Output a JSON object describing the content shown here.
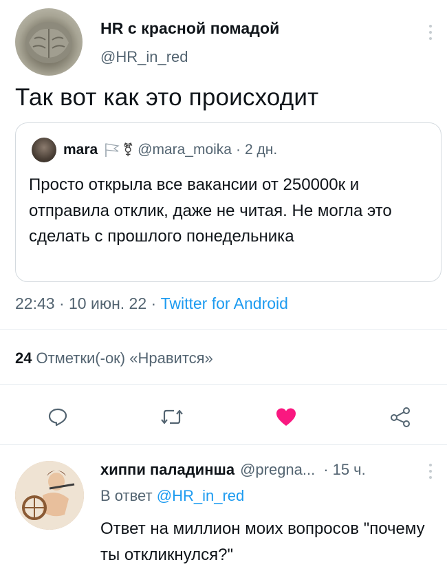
{
  "tweet": {
    "author_name": "HR с красной помадой",
    "author_handle": "@HR_in_red",
    "text": "Так вот как это происходит",
    "timestamp": "22:43 · 10 июн. 22 · ",
    "source": "Twitter for Android",
    "likes_count": "24",
    "likes_label": "Отметки(-ок) «Нравится»"
  },
  "quote": {
    "author_name": "mara",
    "emblem": "⚧",
    "author_handle": "@mara_moika",
    "separator": "·",
    "time": "2 дн.",
    "text": "Просто открыла все вакансии от 250000к и отправила отклик, даже не читая. Не могла это сделать с прошлого понедельника"
  },
  "actions": {
    "reply_icon": "reply-icon",
    "retweet_icon": "retweet-icon",
    "like_icon": "heart-icon",
    "share_icon": "share-icon",
    "like_color": "#f91880"
  },
  "reply": {
    "author_name": "хиппи паладинша",
    "author_handle": "@pregna...",
    "separator": "·",
    "time": "15 ч.",
    "reply_prefix": "В ответ ",
    "reply_to": "@HR_in_red",
    "text": "Ответ на миллион моих вопросов \"почему ты откликнулся?\""
  },
  "colors": {
    "accent": "#1d9bf0",
    "secondary_text": "#536471",
    "like": "#f91880"
  }
}
